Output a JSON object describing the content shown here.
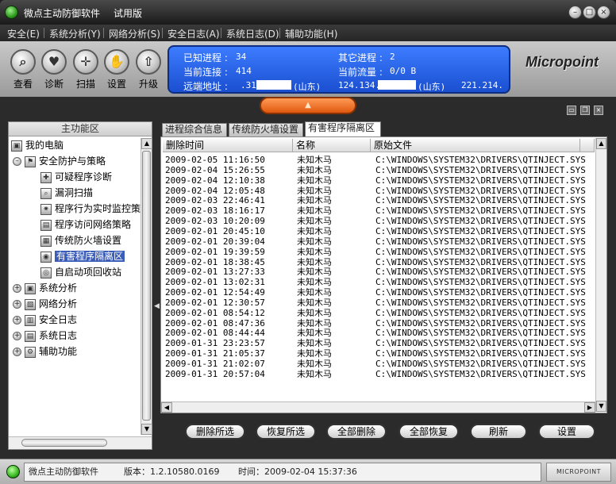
{
  "titlebar": {
    "app_name": "微点主动防御软件",
    "edition": "试用版",
    "min_icon": "minimize-icon",
    "max_icon": "maximize-icon",
    "close_icon": "close-icon"
  },
  "menu": [
    "安全(E)",
    "系统分析(Y)",
    "网络分析(S)",
    "安全日志(A)",
    "系统日志(D)",
    "辅助功能(H)"
  ],
  "toolbar": [
    {
      "label": "查看",
      "icon": "magnifier-icon"
    },
    {
      "label": "诊断",
      "icon": "heart-icon"
    },
    {
      "label": "扫描",
      "icon": "scan-icon"
    },
    {
      "label": "设置",
      "icon": "hand-icon"
    },
    {
      "label": "升级",
      "icon": "upgrade-arrow-icon"
    }
  ],
  "info": {
    "known_process_label": "已知进程 :",
    "known_process_value": "34",
    "other_process_label": "其它进程 :",
    "other_process_value": "2",
    "connections_label": "当前连接 :",
    "connections_value": "414",
    "traffic_label": "当前流量 :",
    "traffic_value": "0/0 B",
    "remote_label": "远端地址 :",
    "remote_ip1": ".31",
    "remote_loc1": "(山东)",
    "remote_ip2": "124.134.",
    "remote_loc2": "(山东)",
    "remote_ip3": "221.214."
  },
  "brand": "Micropoint",
  "left_panel": {
    "header": "主功能区",
    "tree": [
      {
        "label": "我的电脑",
        "icon": "computer-icon"
      },
      {
        "label": "安全防护与策略",
        "icon": "flag-icon"
      },
      {
        "label": "可疑程序诊断",
        "icon": "diagnose-icon"
      },
      {
        "label": "漏洞扫描",
        "icon": "magnifier-icon"
      },
      {
        "label": "程序行为实时监控策",
        "icon": "monitor-icon"
      },
      {
        "label": "程序访问网络策略",
        "icon": "network-window-icon"
      },
      {
        "label": "传统防火墙设置",
        "icon": "firewall-icon"
      },
      {
        "label": "有害程序隔离区",
        "icon": "quarantine-icon"
      },
      {
        "label": "自启动项回收站",
        "icon": "recycle-icon"
      },
      {
        "label": "系统分析",
        "icon": "system-icon"
      },
      {
        "label": "网络分析",
        "icon": "network-icon"
      },
      {
        "label": "安全日志",
        "icon": "log-icon"
      },
      {
        "label": "系统日志",
        "icon": "syslog-icon"
      },
      {
        "label": "辅助功能",
        "icon": "tools-icon"
      }
    ]
  },
  "tabs": [
    "进程综合信息",
    "传统防火墙设置",
    "有害程序隔离区"
  ],
  "table": {
    "columns": [
      "删除时间",
      "名称",
      "原始文件"
    ],
    "rows": [
      [
        "2009-02-05 11:16:50",
        "未知木马",
        "C:\\WINDOWS\\SYSTEM32\\DRIVERS\\QTINJECT.SYS"
      ],
      [
        "2009-02-04 15:26:55",
        "未知木马",
        "C:\\WINDOWS\\SYSTEM32\\DRIVERS\\QTINJECT.SYS"
      ],
      [
        "2009-02-04 12:10:38",
        "未知木马",
        "C:\\WINDOWS\\SYSTEM32\\DRIVERS\\QTINJECT.SYS"
      ],
      [
        "2009-02-04 12:05:48",
        "未知木马",
        "C:\\WINDOWS\\SYSTEM32\\DRIVERS\\QTINJECT.SYS"
      ],
      [
        "2009-02-03 22:46:41",
        "未知木马",
        "C:\\WINDOWS\\SYSTEM32\\DRIVERS\\QTINJECT.SYS"
      ],
      [
        "2009-02-03 18:16:17",
        "未知木马",
        "C:\\WINDOWS\\SYSTEM32\\DRIVERS\\QTINJECT.SYS"
      ],
      [
        "2009-02-03 10:20:09",
        "未知木马",
        "C:\\WINDOWS\\SYSTEM32\\DRIVERS\\QTINJECT.SYS"
      ],
      [
        "2009-02-01 20:45:10",
        "未知木马",
        "C:\\WINDOWS\\SYSTEM32\\DRIVERS\\QTINJECT.SYS"
      ],
      [
        "2009-02-01 20:39:04",
        "未知木马",
        "C:\\WINDOWS\\SYSTEM32\\DRIVERS\\QTINJECT.SYS"
      ],
      [
        "2009-02-01 19:39:59",
        "未知木马",
        "C:\\WINDOWS\\SYSTEM32\\DRIVERS\\QTINJECT.SYS"
      ],
      [
        "2009-02-01 18:38:45",
        "未知木马",
        "C:\\WINDOWS\\SYSTEM32\\DRIVERS\\QTINJECT.SYS"
      ],
      [
        "2009-02-01 13:27:33",
        "未知木马",
        "C:\\WINDOWS\\SYSTEM32\\DRIVERS\\QTINJECT.SYS"
      ],
      [
        "2009-02-01 13:02:31",
        "未知木马",
        "C:\\WINDOWS\\SYSTEM32\\DRIVERS\\QTINJECT.SYS"
      ],
      [
        "2009-02-01 12:54:49",
        "未知木马",
        "C:\\WINDOWS\\SYSTEM32\\DRIVERS\\QTINJECT.SYS"
      ],
      [
        "2009-02-01 12:30:57",
        "未知木马",
        "C:\\WINDOWS\\SYSTEM32\\DRIVERS\\QTINJECT.SYS"
      ],
      [
        "2009-02-01 08:54:12",
        "未知木马",
        "C:\\WINDOWS\\SYSTEM32\\DRIVERS\\QTINJECT.SYS"
      ],
      [
        "2009-02-01 08:47:36",
        "未知木马",
        "C:\\WINDOWS\\SYSTEM32\\DRIVERS\\QTINJECT.SYS"
      ],
      [
        "2009-02-01 08:44:44",
        "未知木马",
        "C:\\WINDOWS\\SYSTEM32\\DRIVERS\\QTINJECT.SYS"
      ],
      [
        "2009-01-31 23:23:57",
        "未知木马",
        "C:\\WINDOWS\\SYSTEM32\\DRIVERS\\QTINJECT.SYS"
      ],
      [
        "2009-01-31 21:05:37",
        "未知木马",
        "C:\\WINDOWS\\SYSTEM32\\DRIVERS\\QTINJECT.SYS"
      ],
      [
        "2009-01-31 21:02:07",
        "未知木马",
        "C:\\WINDOWS\\SYSTEM32\\DRIVERS\\QTINJECT.SYS"
      ],
      [
        "2009-01-31 20:57:04",
        "未知木马",
        "C:\\WINDOWS\\SYSTEM32\\DRIVERS\\QTINJECT.SYS"
      ]
    ]
  },
  "buttons": [
    "删除所选",
    "恢复所选",
    "全部删除",
    "全部恢复",
    "刷新",
    "设置"
  ],
  "status": {
    "app_name": "微点主动防御软件",
    "version": "版本：1.2.10580.0169",
    "time": "时间：2009-02-04 15:37:36",
    "logo": "MICROPOINT"
  },
  "colors": {
    "accent_blue": "#2a5fe0",
    "collapse_orange": "#f07020",
    "selection": "#3a5dba"
  }
}
